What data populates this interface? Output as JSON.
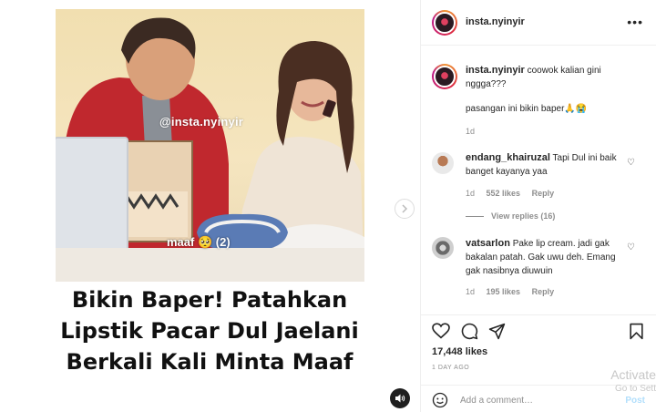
{
  "post": {
    "username": "insta.nyinyir",
    "more_icon": "more-horizontal-icon",
    "watermark": "@insta.nyinyir",
    "overlay_caption": "maaf 🥺 (2)",
    "headline": "Bikin Baper! Patahkan Lipstik Pacar Dul Jaelani Berkali Kali Minta Maaf"
  },
  "caption": {
    "username": "insta.nyinyir",
    "text_line1": "coowok kalian gini nggga???",
    "text_line2": "pasangan ini bikin baper🙏😭",
    "time": "1d"
  },
  "comments": [
    {
      "username": "endang_khairuzal",
      "text": "Tapi Dul ini baik banget kayanya yaa",
      "time": "1d",
      "likes": "552 likes",
      "reply": "Reply",
      "view_replies": "View replies (16)"
    },
    {
      "username": "vatsarlon",
      "text": "Pake lip cream. jadi gak bakalan patah. Gak uwu deh. Emang gak nasibnya diuwuin",
      "time": "1d",
      "likes": "195 likes",
      "reply": "Reply"
    }
  ],
  "actions": {
    "likes_count": "17,448 likes",
    "date": "1 DAY AGO",
    "add_comment_placeholder": "Add a comment…",
    "post_label": "Post"
  },
  "watermark_os": {
    "line1": "Activate",
    "line2": "Go to Sett"
  },
  "colors": {
    "accent_blue": "#b2dffc",
    "muted_text": "#8e8e8e",
    "text": "#262626"
  }
}
